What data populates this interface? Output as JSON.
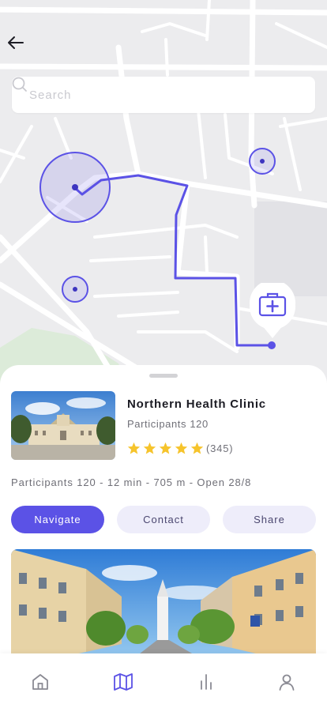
{
  "search": {
    "placeholder": "Search"
  },
  "clinic": {
    "name": "Northern Health Clinic",
    "subtitle": "Participants 120",
    "rating": 5,
    "reviews": "(345)",
    "meta": "Participants 120 - 12 min - 705 m - Open 28/8"
  },
  "actions": {
    "navigate": "Navigate",
    "contact": "Contact",
    "share": "Share"
  },
  "tabs": [
    "home-icon",
    "map-icon",
    "stats-icon",
    "profile-icon"
  ],
  "colors": {
    "accent": "#5b52e6",
    "accent_soft": "#eeedfa",
    "star": "#f6c42c",
    "map_bg": "#ececee"
  }
}
